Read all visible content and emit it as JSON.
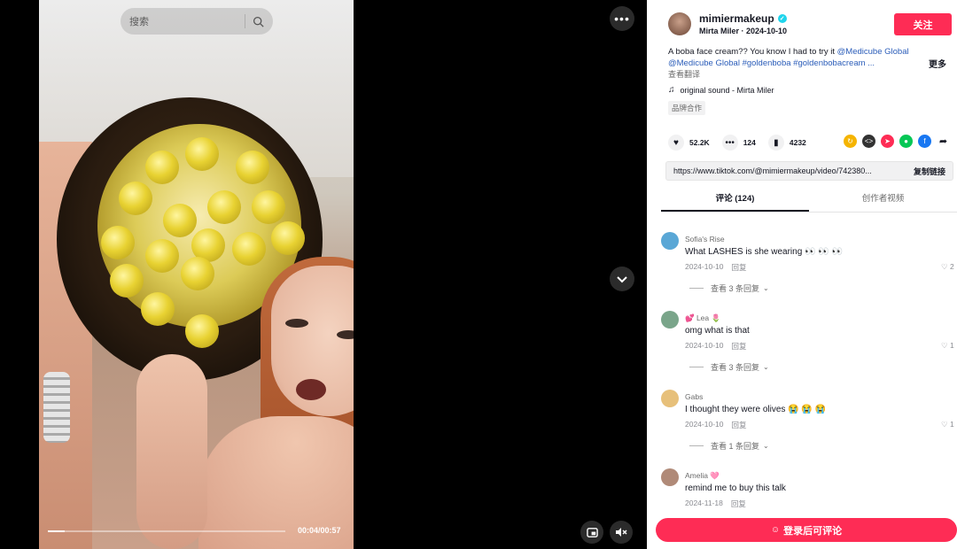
{
  "video": {
    "search_placeholder": "搜索",
    "time": "00:04/00:57",
    "progress": 0.07
  },
  "author": {
    "username": "mimiermakeup",
    "display_and_date": "Mirta Miler · 2024-10-10",
    "follow_label": "关注"
  },
  "description": {
    "text": "A boba face cream?? You know I had to try it ",
    "tag1": "@Medicube Global",
    "tag2": "@Medicube Global",
    "tag3": "#goldenboba",
    "tag4": "#goldenbobacream ...",
    "more": "更多",
    "translate": "查看翻译"
  },
  "music": "original sound - Mirta Miler",
  "brand_tag": "品牌合作",
  "stats": {
    "likes": "52.2K",
    "comments": "124",
    "saves": "4232"
  },
  "share_colors": [
    "#f5b400",
    "#333333",
    "#fe2c55",
    "#06c755",
    "#1877f2"
  ],
  "link": {
    "url": "https://www.tiktok.com/@mimiermakeup/video/742380...",
    "copy_label": "复制链接"
  },
  "tabs": [
    {
      "label": "评论 (124)"
    },
    {
      "label": "创作者视频"
    }
  ],
  "comments": [
    {
      "user": "Sofia's Rise",
      "text": "What LASHES is she wearing 👀 👀 👀",
      "date": "2024-10-10",
      "reply": "回复",
      "likes": "2",
      "replies": "查看 3 条回复",
      "avatar_color": "#5aa7d6"
    },
    {
      "user": "💕 Lea 🌷",
      "text": "omg what is that",
      "date": "2024-10-10",
      "reply": "回复",
      "likes": "1",
      "replies": "查看 3 条回复",
      "avatar_color": "#7aa58a"
    },
    {
      "user": "Gabs",
      "text": "I thought they were olives 😭 😭 😭",
      "date": "2024-10-10",
      "reply": "回复",
      "likes": "1",
      "replies": "查看 1 条回复",
      "avatar_color": "#e7c07a"
    },
    {
      "user": "Amelia 🩷",
      "text": "remind me to buy this talk",
      "date": "2024-11-18",
      "reply": "回复",
      "likes": "",
      "replies": "",
      "avatar_color": "#b08a78"
    }
  ],
  "bottom_cta": "登录后可评论"
}
